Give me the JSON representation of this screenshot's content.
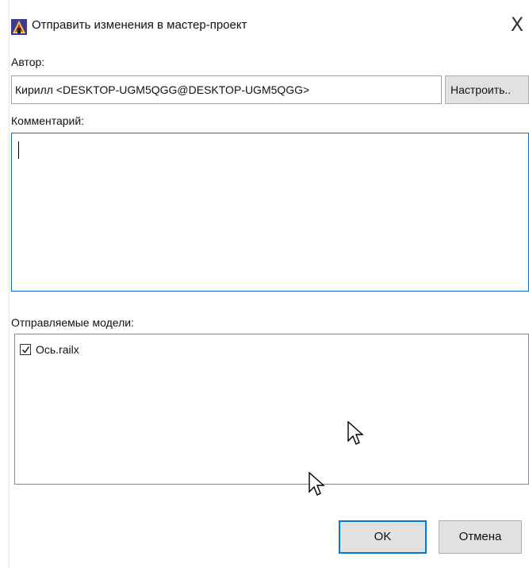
{
  "window": {
    "title": "Отправить изменения в мастер-проект",
    "close_glyph": "X",
    "app_icon": "app-logo-icon"
  },
  "author": {
    "label": "Автор:",
    "value": "Кирилл <DESKTOP-UGM5QGG@DESKTOP-UGM5QGG>",
    "setup_button": "Настроить.."
  },
  "comment": {
    "label": "Комментарий:",
    "value": ""
  },
  "models": {
    "label": "Отправляемые модели:",
    "items": [
      {
        "name": "Ось.railx",
        "checked": true
      }
    ]
  },
  "buttons": {
    "ok": "OK",
    "cancel": "Отмена"
  },
  "colors": {
    "focus_border": "#0a6cc7",
    "default_button_border": "#0078d7",
    "button_face": "#e1e1e1"
  }
}
